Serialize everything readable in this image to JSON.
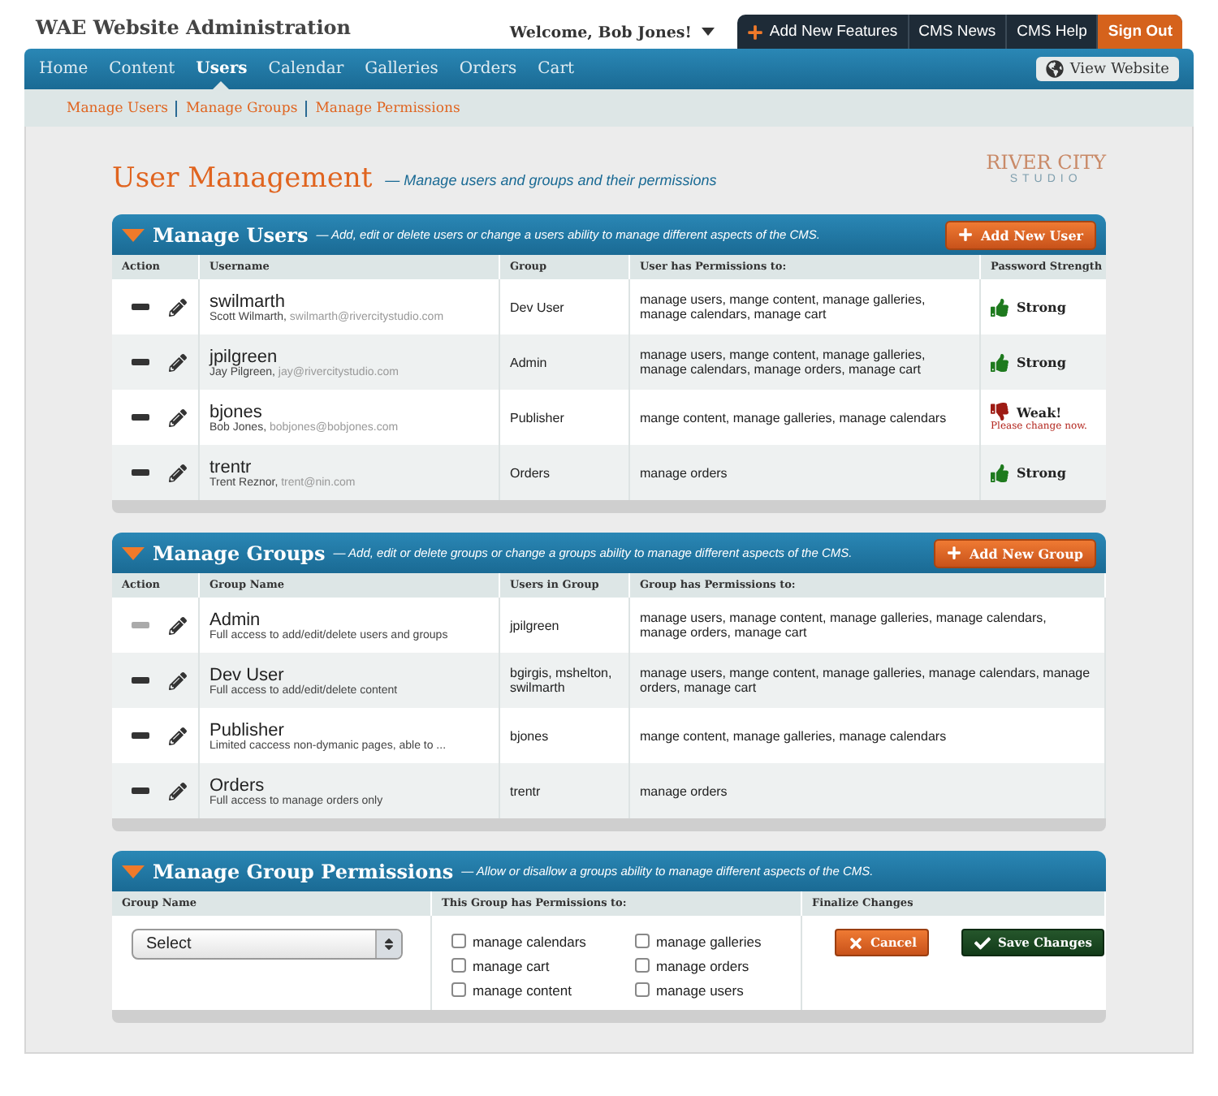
{
  "header": {
    "title": "WAE Website Administration",
    "welcome": "Welcome, Bob Jones!",
    "top_links": [
      {
        "label": "Add New Features",
        "kind": "feature"
      },
      {
        "label": "CMS News",
        "kind": "link"
      },
      {
        "label": "CMS Help",
        "kind": "link"
      },
      {
        "label": "Sign Out",
        "kind": "signout"
      }
    ]
  },
  "nav": {
    "items": [
      {
        "label": "Home",
        "selected": false
      },
      {
        "label": "Content",
        "selected": false
      },
      {
        "label": "Users",
        "selected": true
      },
      {
        "label": "Calendar",
        "selected": false
      },
      {
        "label": "Galleries",
        "selected": false
      },
      {
        "label": "Orders",
        "selected": false
      },
      {
        "label": "Cart",
        "selected": false
      }
    ],
    "view_website": "View Website"
  },
  "subnav": [
    "Manage Users",
    "Manage Groups",
    "Manage Permissions"
  ],
  "page": {
    "title": "User Management",
    "subtitle": "— Manage users and groups and their permissions",
    "logo": {
      "name": "RIVER CITY",
      "tag": "STUDIO"
    }
  },
  "users": {
    "title": "Manage Users",
    "description": "— Add, edit or delete users or change a users ability to manage different aspects of the CMS.",
    "add_button": "Add New User",
    "columns": [
      "Action",
      "Username",
      "Group",
      "User has Permissions to:",
      "Password Strength"
    ],
    "rows": [
      {
        "username": "swilmarth",
        "full_name": "Scott Wilmarth,",
        "email": "swilmarth@rivercitystudio.com",
        "group": "Dev User",
        "permissions": "manage users, mange content, manage galleries, manage calendars, manage cart",
        "strength": {
          "kind": "strong",
          "label": "Strong"
        }
      },
      {
        "username": "jpilgreen",
        "full_name": "Jay Pilgreen,",
        "email": "jay@rivercitystudio.com",
        "group": "Admin",
        "permissions": "manage users, mange content, manage galleries, manage calendars, manage orders, manage cart",
        "strength": {
          "kind": "strong",
          "label": "Strong"
        }
      },
      {
        "username": "bjones",
        "full_name": "Bob Jones,",
        "email": "bobjones@bobjones.com",
        "group": "Publisher",
        "permissions": "mange content, manage galleries, manage calendars",
        "strength": {
          "kind": "weak",
          "label": "Weak!",
          "note": "Please change now."
        }
      },
      {
        "username": "trentr",
        "full_name": "Trent Reznor,",
        "email": "trent@nin.com",
        "group": "Orders",
        "permissions": "manage orders",
        "strength": {
          "kind": "strong",
          "label": "Strong"
        }
      }
    ]
  },
  "groups": {
    "title": "Manage Groups",
    "description": "— Add, edit or delete groups or change a groups ability to manage different aspects of the CMS.",
    "add_button": "Add New Group",
    "columns": [
      "Action",
      "Group Name",
      "Users in Group",
      "Group has Permissions to:"
    ],
    "rows": [
      {
        "name": "Admin",
        "description": "Full access to add/edit/delete users and groups",
        "users": "jpilgreen",
        "permissions": "manage users, manage content, manage galleries, manage calendars, manage orders, manage cart",
        "delete_disabled": true
      },
      {
        "name": "Dev User",
        "description": "Full access to add/edit/delete content",
        "users": "bgirgis, mshelton, swilmarth",
        "permissions": "manage users, mange content, manage galleries, manage calendars, manage orders, manage cart",
        "delete_disabled": false
      },
      {
        "name": "Publisher",
        "description": "Limited caccess non-dymanic pages, able to ...",
        "users": "bjones",
        "permissions": "mange content, manage galleries, manage calendars",
        "delete_disabled": false
      },
      {
        "name": "Orders",
        "description": "Full access to manage orders only",
        "users": "trentr",
        "permissions": "manage orders",
        "delete_disabled": false
      }
    ]
  },
  "permissions": {
    "title": "Manage Group Permissions",
    "description": "— Allow or disallow a groups ability to manage different aspects of the CMS.",
    "columns": [
      "Group Name",
      "This Group has Permissions to:",
      "Finalize Changes"
    ],
    "select": {
      "value": "Select"
    },
    "options": [
      {
        "label": "manage calendars",
        "checked": false
      },
      {
        "label": "manage cart",
        "checked": false
      },
      {
        "label": "manage content",
        "checked": false
      },
      {
        "label": "manage galleries",
        "checked": false
      },
      {
        "label": "manage orders",
        "checked": false
      },
      {
        "label": "manage users",
        "checked": false
      }
    ],
    "buttons": [
      {
        "label": "Cancel",
        "kind": "cancel"
      },
      {
        "label": "Save Changes",
        "kind": "save"
      }
    ]
  }
}
